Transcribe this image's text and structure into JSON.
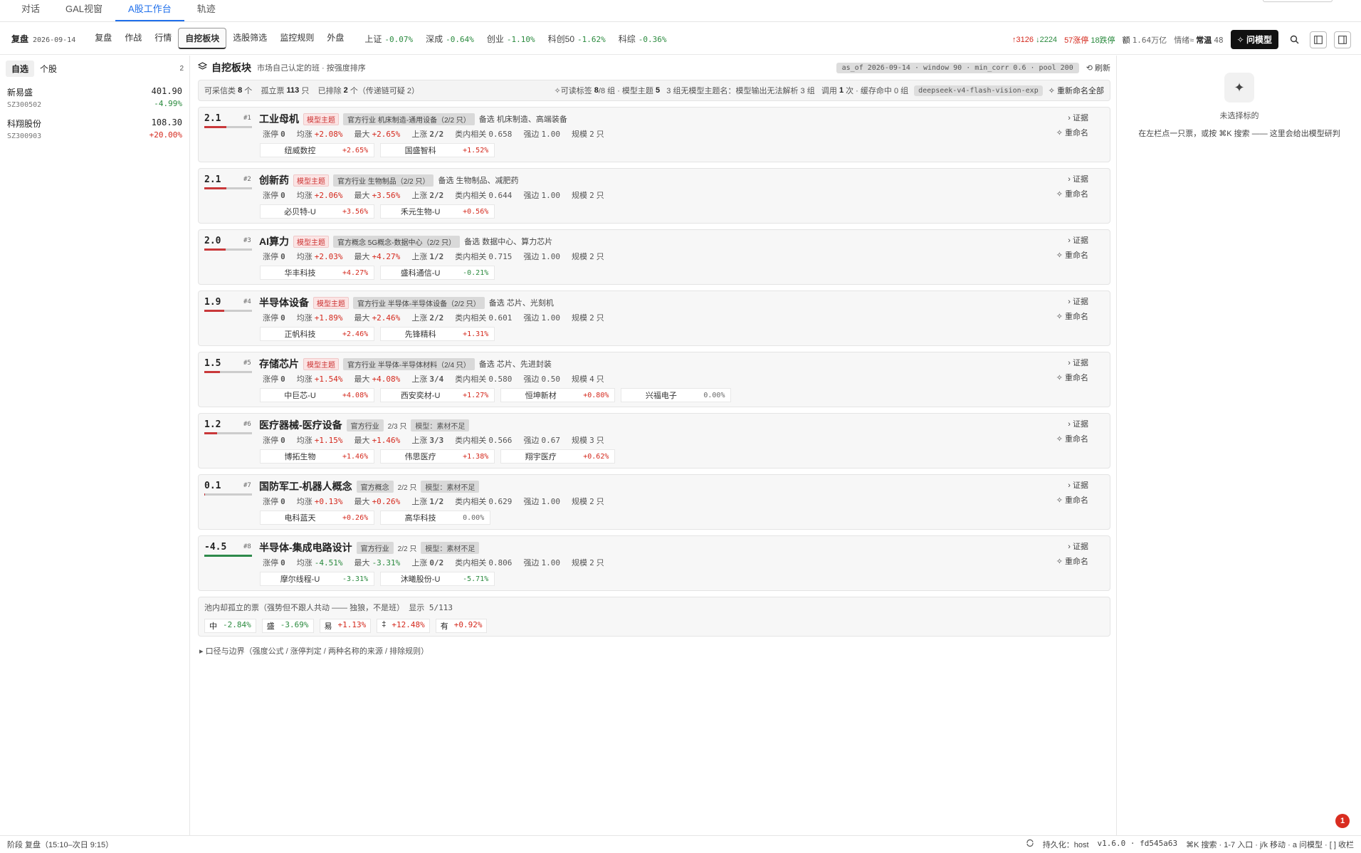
{
  "topnav": {
    "tabs": [
      "对话",
      "GAL视窗",
      "A股工作台",
      "轨迹"
    ]
  },
  "toolbar": {
    "mode": "复盘",
    "date": "2026-09-14",
    "tabs": [
      "复盘",
      "作战",
      "行情",
      "自挖板块",
      "选股筛选",
      "监控规则",
      "外盘"
    ],
    "indices": [
      {
        "name": "上证",
        "value": "-0.07%"
      },
      {
        "name": "深成",
        "value": "-0.64%"
      },
      {
        "name": "创业",
        "value": "-1.10%"
      },
      {
        "name": "科创50",
        "value": "-1.62%"
      },
      {
        "name": "科综",
        "value": "-0.36%"
      }
    ],
    "up": "↑3126",
    "down": "↓2224",
    "limit_up": "57涨停",
    "limit_down": "18跌停",
    "turnover_label": "额",
    "turnover": "1.64万亿",
    "mood_label": "情绪≈",
    "mood": "常温",
    "mood_val": "48",
    "ask": "✧ 问模型"
  },
  "sidebar": {
    "tabs": [
      "自选",
      "个股"
    ],
    "count": "2",
    "stocks": [
      {
        "name": "新易盛",
        "code": "SZ300502",
        "price": "401.90",
        "change": "-4.99%"
      },
      {
        "name": "科翔股份",
        "code": "SZ300903",
        "price": "108.30",
        "change": "+20.00%"
      }
    ]
  },
  "main": {
    "title": "自挖板块",
    "subtitle": "市场自己认定的班 · 按强度排序",
    "asof": "as_of 2026-09-14 · window 90 · min_corr 0.6 · pool 200",
    "refresh": "⟲ 刷新",
    "summary": {
      "t1": "可采信类",
      "v1": "8",
      "u1": "个",
      "t2": "孤立票",
      "v2": "113",
      "u2": "只",
      "t3": "已排除",
      "v3": "2",
      "u3": "个（传递链可疑 2）",
      "t4": "✧可读标签",
      "v4": "8",
      "u4": "/8 组 · 模型主题",
      "v5": "5",
      "t5": "3 组无模型主题名：模型输出无法解析 3 组",
      "t6": "调用",
      "v6": "1",
      "u6": "次 · 缓存命中 0 组",
      "model": "deepseek-v4-flash-vision-exp",
      "rename_all": "✧ 重新命名全部"
    },
    "labels": {
      "zt": "涨停",
      "avg": "均涨",
      "max": "最大",
      "up": "上涨",
      "corr": "类内相关",
      "edge": "强边",
      "scale": "规模",
      "unit": "只",
      "proof": "› 证据",
      "rename": "✧ 重命名"
    },
    "cards": [
      {
        "score": "2.1",
        "rank": "#1",
        "name": "工业母机",
        "model_tag": "模型主题",
        "official": "官方行业 机床制造-通用设备（2/2 只）",
        "alt": "备选 机床制造、高端装备",
        "zt": "0",
        "avg": "+2.08%",
        "max": "+2.65%",
        "up": "2/2",
        "corr": "0.658",
        "edge": "1.00",
        "scale": "2",
        "stocks": [
          {
            "n": "纽威数控",
            "c": "+2.65%"
          },
          {
            "n": "国盛智科",
            "c": "+1.52%"
          }
        ]
      },
      {
        "score": "2.1",
        "rank": "#2",
        "name": "创新药",
        "model_tag": "模型主题",
        "official": "官方行业 生物制品（2/2 只）",
        "alt": "备选 生物制品、减肥药",
        "zt": "0",
        "avg": "+2.06%",
        "max": "+3.56%",
        "up": "2/2",
        "corr": "0.644",
        "edge": "1.00",
        "scale": "2",
        "stocks": [
          {
            "n": "必贝特-U",
            "c": "+3.56%"
          },
          {
            "n": "禾元生物-U",
            "c": "+0.56%"
          }
        ]
      },
      {
        "score": "2.0",
        "rank": "#3",
        "name": "AI算力",
        "model_tag": "模型主题",
        "official": "官方概念 5G概念-数据中心（2/2 只）",
        "alt": "备选 数据中心、算力芯片",
        "zt": "0",
        "avg": "+2.03%",
        "max": "+4.27%",
        "up": "1/2",
        "corr": "0.715",
        "edge": "1.00",
        "scale": "2",
        "stocks": [
          {
            "n": "华丰科技",
            "c": "+4.27%"
          },
          {
            "n": "盛科通信-U",
            "c": "-0.21%"
          }
        ]
      },
      {
        "score": "1.9",
        "rank": "#4",
        "name": "半导体设备",
        "model_tag": "模型主题",
        "official": "官方行业 半导体-半导体设备（2/2 只）",
        "alt": "备选 芯片、光刻机",
        "zt": "0",
        "avg": "+1.89%",
        "max": "+2.46%",
        "up": "2/2",
        "corr": "0.601",
        "edge": "1.00",
        "scale": "2",
        "stocks": [
          {
            "n": "正帆科技",
            "c": "+2.46%"
          },
          {
            "n": "先锋精科",
            "c": "+1.31%"
          }
        ]
      },
      {
        "score": "1.5",
        "rank": "#5",
        "name": "存储芯片",
        "model_tag": "模型主题",
        "official": "官方行业 半导体-半导体材料（2/4 只）",
        "alt": "备选 芯片、先进封装",
        "zt": "0",
        "avg": "+1.54%",
        "max": "+4.08%",
        "up": "3/4",
        "corr": "0.580",
        "edge": "0.50",
        "scale": "4",
        "stocks": [
          {
            "n": "中巨芯-U",
            "c": "+4.08%"
          },
          {
            "n": "西安奕材-U",
            "c": "+1.27%"
          },
          {
            "n": "恒坤新材",
            "c": "+0.80%"
          },
          {
            "n": "兴福电子",
            "c": "0.00%"
          }
        ]
      },
      {
        "score": "1.2",
        "rank": "#6",
        "name": "医疗器械-医疗设备",
        "model_tag": "",
        "official": "官方行业",
        "cnt": "2/3 只",
        "insuf": "模型：素材不足",
        "alt": "",
        "zt": "0",
        "avg": "+1.15%",
        "max": "+1.46%",
        "up": "3/3",
        "corr": "0.566",
        "edge": "0.67",
        "scale": "3",
        "stocks": [
          {
            "n": "博拓生物",
            "c": "+1.46%"
          },
          {
            "n": "伟思医疗",
            "c": "+1.38%"
          },
          {
            "n": "翔宇医疗",
            "c": "+0.62%"
          }
        ]
      },
      {
        "score": "0.1",
        "rank": "#7",
        "name": "国防军工-机器人概念",
        "model_tag": "",
        "official": "官方概念",
        "cnt": "2/2 只",
        "insuf": "模型：素材不足",
        "alt": "",
        "zt": "0",
        "avg": "+0.13%",
        "max": "+0.26%",
        "up": "1/2",
        "corr": "0.629",
        "edge": "1.00",
        "scale": "2",
        "stocks": [
          {
            "n": "电科蓝天",
            "c": "+0.26%"
          },
          {
            "n": "高华科技",
            "c": "0.00%"
          }
        ]
      },
      {
        "score": "-4.5",
        "rank": "#8",
        "name": "半导体-集成电路设计",
        "model_tag": "",
        "official": "官方行业",
        "cnt": "2/2 只",
        "insuf": "模型：素材不足",
        "alt": "",
        "zt": "0",
        "avg": "-4.51%",
        "max": "-3.31%",
        "up": "0/2",
        "corr": "0.806",
        "edge": "1.00",
        "scale": "2",
        "stocks": [
          {
            "n": "摩尔线程-U",
            "c": "-3.31%"
          },
          {
            "n": "沐曦股份-U",
            "c": "-5.71%"
          }
        ]
      }
    ],
    "isolated": {
      "title": "池内却孤立的票（强势但不跟人共动 —— 独狼，不是班）",
      "shown": "显示 5/113",
      "items": [
        {
          "n": "中",
          "c": "-2.84%"
        },
        {
          "n": "盛",
          "c": "-3.69%"
        },
        {
          "n": "易",
          "c": "+1.13%"
        },
        {
          "n": "‡",
          "c": "+12.48%"
        },
        {
          "n": "有",
          "c": "+0.92%"
        }
      ]
    },
    "disclosure": "▸ 口径与边界（强度公式 / 涨停判定 / 两种名称的来源 / 排除规则）"
  },
  "right": {
    "icon": "✦",
    "line1": "未选择标的",
    "line2": "在左栏点一只票，或按 ⌘K 搜索 —— 这里会给出模型研判"
  },
  "status": {
    "left": "阶段 复盘（15:10–次日 9:15）",
    "persist": "持久化：host",
    "version": "v1.6.0 · fd545a63",
    "hint": "⌘K 搜索 · 1-7 入口 · j/k 移动 · a 问模型 · [ ] 收栏",
    "notif": "1"
  },
  "colors": {
    "accent": "#1f6feb",
    "up": "#d4281c",
    "down": "#2a8a3e"
  }
}
